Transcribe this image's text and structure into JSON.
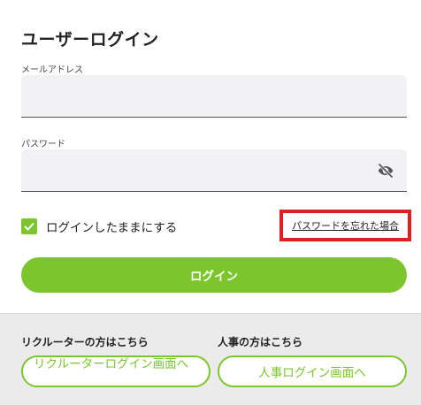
{
  "page": {
    "title": "ユーザーログイン"
  },
  "form": {
    "email_label": "メールアドレス",
    "email_value": "",
    "password_label": "パスワード",
    "password_value": "",
    "password_toggle_icon": "eye-off-icon",
    "remember_label": "ログインしたままにする",
    "remember_checked": true,
    "forgot_link": "パスワードを忘れた場合",
    "login_button": "ログイン"
  },
  "other_logins": {
    "recruiter_heading": "リクルーターの方はこちら",
    "recruiter_button": "リクルーターログイン画面へ",
    "hr_heading": "人事の方はこちら",
    "hr_button": "人事ログイン画面へ"
  },
  "colors": {
    "accent": "#7cc52c",
    "highlight": "#e01f1f",
    "input_bg": "#f2f2f5",
    "footer_bg": "#ebebeb"
  }
}
